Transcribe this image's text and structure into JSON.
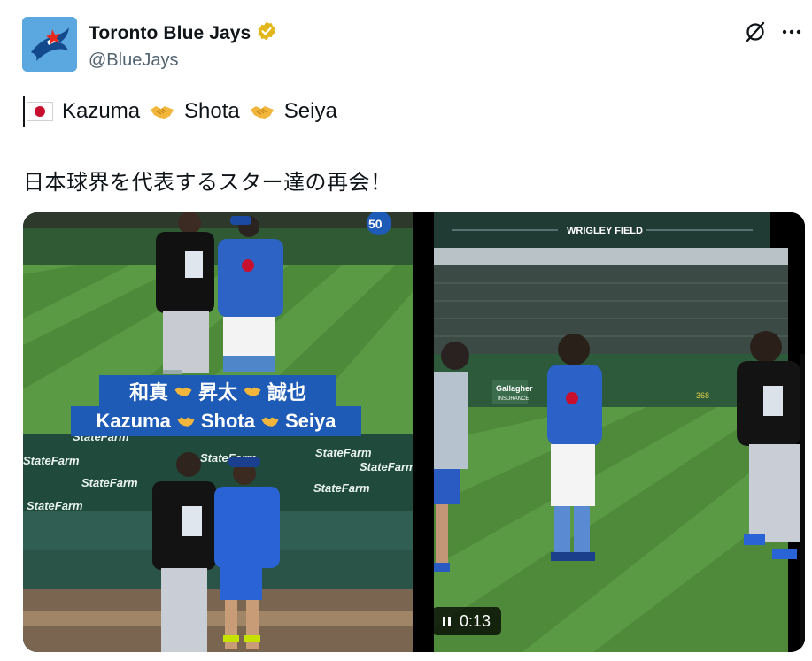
{
  "account": {
    "display_name": "Toronto Blue Jays",
    "handle": "@BlueJays",
    "verified": "gold-verified-icon"
  },
  "tweet": {
    "names": [
      "Kazuma",
      "Shota",
      "Seiya"
    ],
    "line2": "日本球界を代表するスター達の再会！"
  },
  "media": {
    "photo_caption_jp": [
      "和真",
      "昇太",
      "誠也"
    ],
    "photo_caption_en": [
      "Kazuma",
      "Shota",
      "Seiya"
    ],
    "signage": {
      "wrigley": "WRIGLEY FIELD",
      "statefarm": "StateFarm",
      "gallagher": "Gallagher",
      "insurance": "INSURANCE",
      "number": "368"
    },
    "video_time": "0:13"
  },
  "colors": {
    "caption_bg": "#1d5bb6",
    "verified_gold": "#e2b719",
    "grass": "#4f8a3a"
  }
}
